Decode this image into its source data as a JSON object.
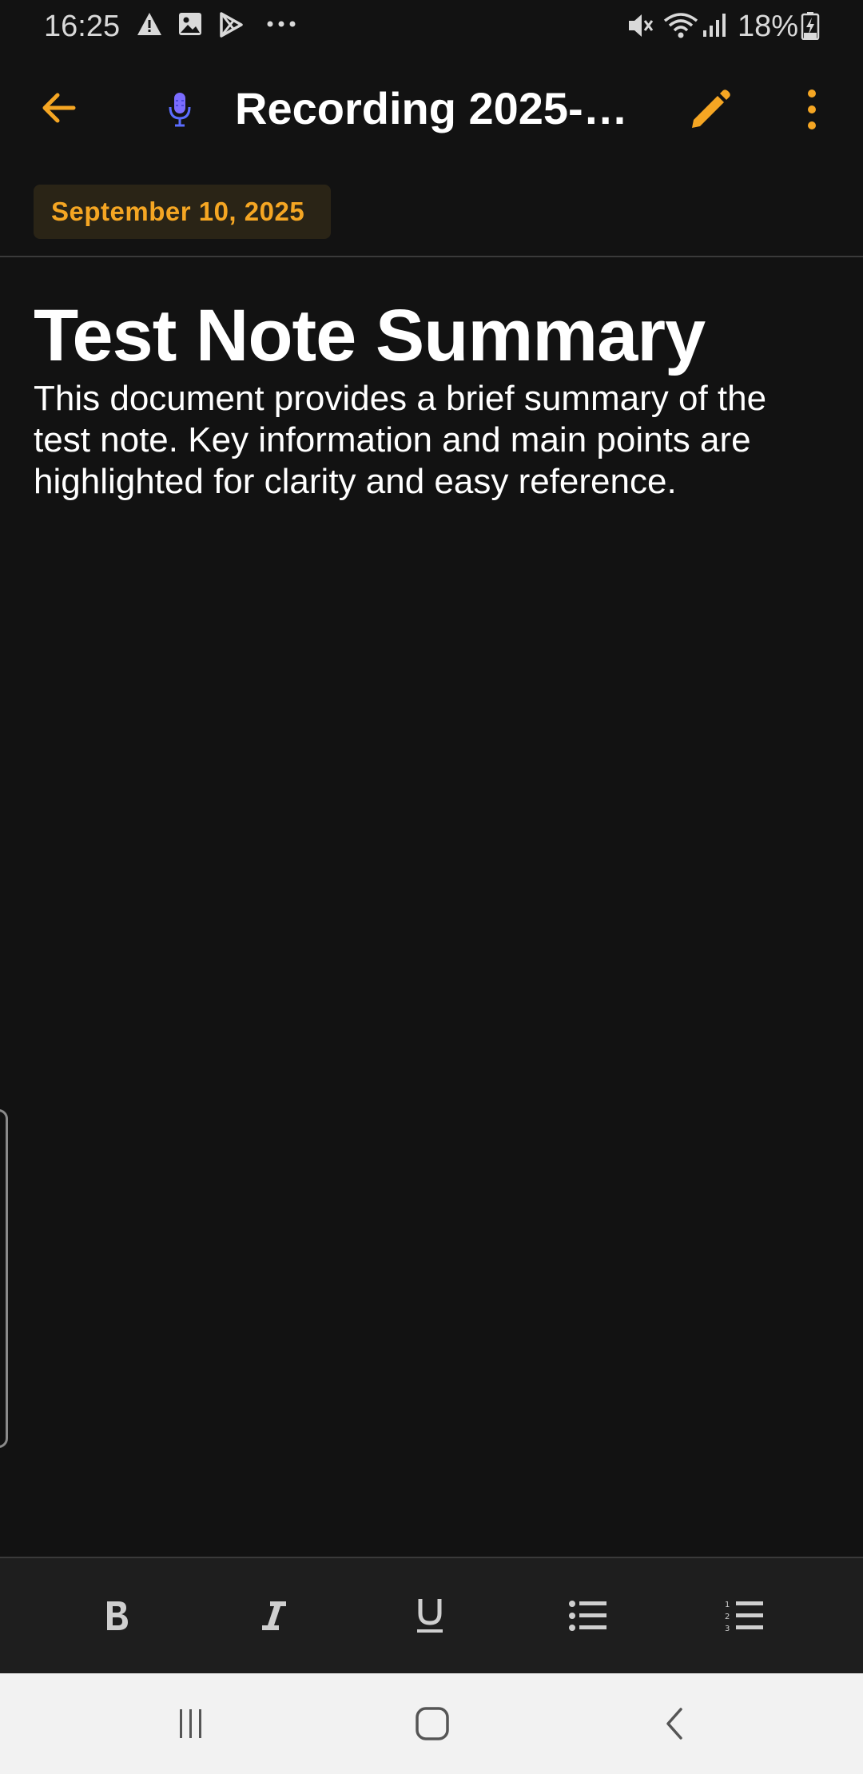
{
  "status_bar": {
    "time": "16:25",
    "battery": "18%",
    "icons": [
      "alert-icon",
      "gallery-icon",
      "play-store-icon",
      "more-notifications-icon",
      "mute-icon",
      "wifi-icon",
      "signal-icon",
      "battery-charging-icon"
    ]
  },
  "app_bar": {
    "title": "Recording 2025-…",
    "back_icon": "arrow-left-icon",
    "recording_icon": "microphone-icon",
    "edit_icon": "pencil-icon",
    "menu_icon": "more-vertical-icon"
  },
  "note": {
    "date": "September 10, 2025",
    "heading": "Test Note Summary",
    "body": "This document provides a brief summary of the test note. Key information and main points are highlighted for clarity and easy reference."
  },
  "toolbar": {
    "items": [
      "bold",
      "italic",
      "underline",
      "bulleted-list",
      "numbered-list"
    ]
  },
  "nav": {
    "items": [
      "recents",
      "home",
      "back"
    ]
  },
  "colors": {
    "accent": "#f5a623",
    "background": "#121212",
    "toolbar": "#1e1e1e",
    "mic": "#6b6bff"
  }
}
